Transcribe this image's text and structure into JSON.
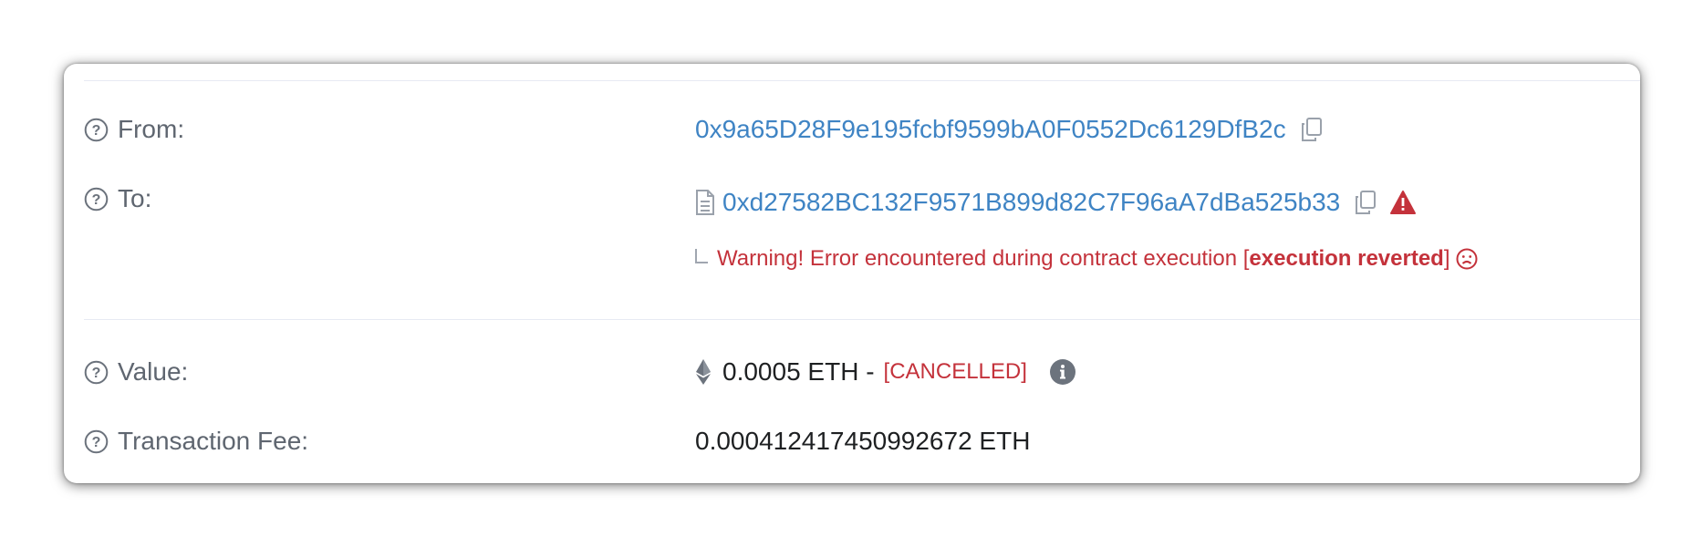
{
  "rows": {
    "from": {
      "label": "From:",
      "address": "0x9a65D28F9e195fcbf9599bA0F0552Dc6129DfB2c"
    },
    "to": {
      "label": "To:",
      "address": "0xd27582BC132F9571B899d82C7F96aA7dBa525b33",
      "warning_prefix": "Warning! Error encountered during contract execution [",
      "warning_bold": "execution reverted",
      "warning_suffix": "]"
    },
    "value": {
      "label": "Value:",
      "amount": "0.0005 ETH -",
      "status": "[CANCELLED]"
    },
    "fee": {
      "label": "Transaction Fee:",
      "amount": "0.000412417450992672 ETH"
    }
  },
  "icons": {
    "help": "question-circle-icon",
    "copy": "copy-icon",
    "contract": "document-icon",
    "alert": "warning-triangle-icon",
    "frown": "frown-icon",
    "eth": "ethereum-icon",
    "info": "info-circle-icon"
  },
  "colors": {
    "link": "#3f84c4",
    "error": "#c4323b",
    "label": "#5f6670",
    "text": "#1e2022"
  }
}
